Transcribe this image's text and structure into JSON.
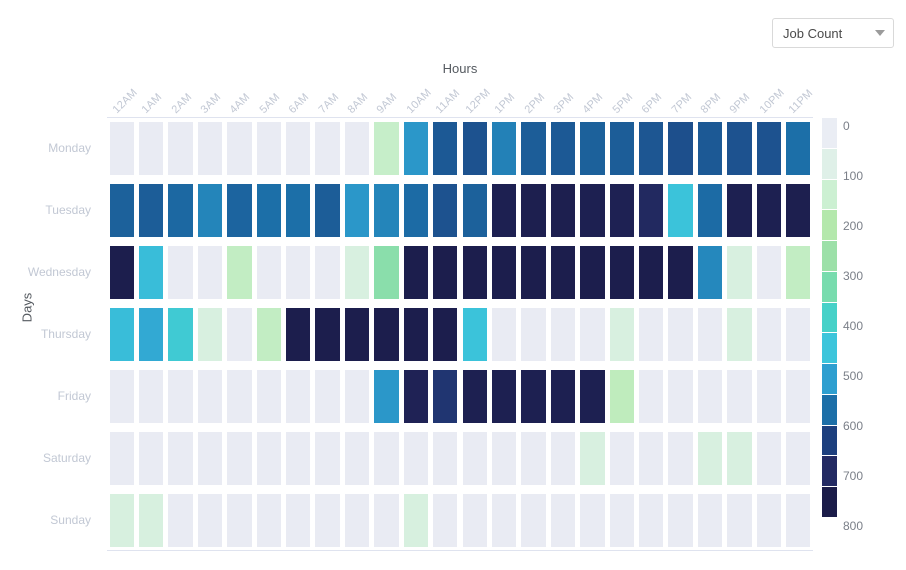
{
  "metric_selector": {
    "value": "Job Count",
    "caret_icon": "chevron-down-icon"
  },
  "chart_data": {
    "type": "heatmap",
    "title": "",
    "xlabel": "Hours",
    "ylabel": "Days",
    "x": [
      "12AM",
      "1AM",
      "2AM",
      "3AM",
      "4AM",
      "5AM",
      "6AM",
      "7AM",
      "8AM",
      "9AM",
      "10AM",
      "11AM",
      "12PM",
      "1PM",
      "2PM",
      "3PM",
      "4PM",
      "5PM",
      "6PM",
      "7PM",
      "8PM",
      "9PM",
      "10PM",
      "11PM"
    ],
    "y": [
      "Monday",
      "Tuesday",
      "Wednesday",
      "Thursday",
      "Friday",
      "Saturday",
      "Sunday"
    ],
    "zlabel": "Job Count",
    "zlim": [
      0,
      800
    ],
    "colorbar_ticks": [
      0,
      100,
      200,
      300,
      400,
      500,
      600,
      700,
      800
    ],
    "colorscale": [
      "#eaedf4",
      "#dff0e8",
      "#ccf0d2",
      "#b4e8ac",
      "#9ce0a8",
      "#78dcae",
      "#46d1c8",
      "#3cc5db",
      "#2e9fd0",
      "#1c6fa8",
      "#1d3f7e",
      "#232a63",
      "#1b1c49"
    ],
    "empty_color": "#e9ebf3",
    "values": [
      [
        0,
        0,
        0,
        0,
        0,
        0,
        0,
        0,
        0,
        150,
        545,
        630,
        640,
        575,
        625,
        630,
        620,
        625,
        635,
        645,
        630,
        640,
        640,
        600
      ],
      [
        620,
        625,
        610,
        570,
        615,
        600,
        600,
        625,
        545,
        570,
        605,
        640,
        620,
        780,
        785,
        785,
        780,
        775,
        740,
        470,
        605,
        780,
        780,
        785
      ],
      [
        790,
        480,
        0,
        0,
        160,
        0,
        0,
        0,
        90,
        300,
        790,
        790,
        790,
        790,
        790,
        790,
        790,
        790,
        790,
        790,
        565,
        90,
        0,
        160
      ],
      [
        480,
        515,
        440,
        90,
        0,
        160,
        790,
        790,
        790,
        790,
        790,
        790,
        470,
        0,
        0,
        0,
        0,
        90,
        0,
        0,
        0,
        90,
        0,
        0
      ],
      [
        0,
        0,
        0,
        0,
        0,
        0,
        0,
        0,
        0,
        545,
        770,
        700,
        780,
        780,
        780,
        780,
        780,
        170,
        0,
        0,
        0,
        0,
        0,
        0
      ],
      [
        0,
        0,
        0,
        0,
        0,
        0,
        0,
        0,
        0,
        0,
        0,
        0,
        0,
        0,
        0,
        0,
        90,
        0,
        0,
        0,
        90,
        90,
        0,
        0
      ],
      [
        95,
        95,
        0,
        0,
        0,
        0,
        0,
        0,
        0,
        0,
        95,
        0,
        0,
        0,
        0,
        0,
        0,
        0,
        0,
        0,
        0,
        0,
        0,
        0
      ]
    ]
  }
}
